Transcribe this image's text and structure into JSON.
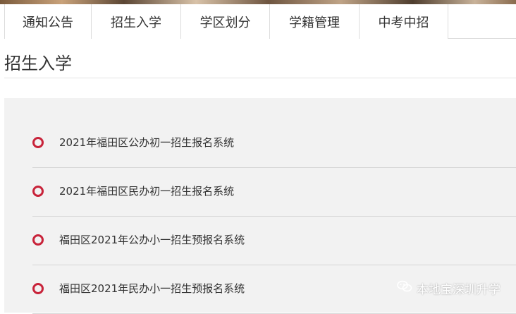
{
  "tabs": [
    {
      "label": "通知公告"
    },
    {
      "label": "招生入学"
    },
    {
      "label": "学区划分"
    },
    {
      "label": "学籍管理"
    },
    {
      "label": "中考中招"
    }
  ],
  "section": {
    "title": "招生入学"
  },
  "links": [
    {
      "label": "2021年福田区公办初一招生报名系统"
    },
    {
      "label": "2021年福田区民办初一招生报名系统"
    },
    {
      "label": "福田区2021年公办小一招生预报名系统"
    },
    {
      "label": "福田区2021年民办小一招生预报名系统"
    }
  ],
  "watermark": {
    "text": "本地宝深圳升学",
    "icon": "wechat-icon"
  },
  "colors": {
    "accent": "#c8233a",
    "panel_bg": "#f2f2f2",
    "text": "#333333",
    "divider": "#d6d6d6"
  }
}
